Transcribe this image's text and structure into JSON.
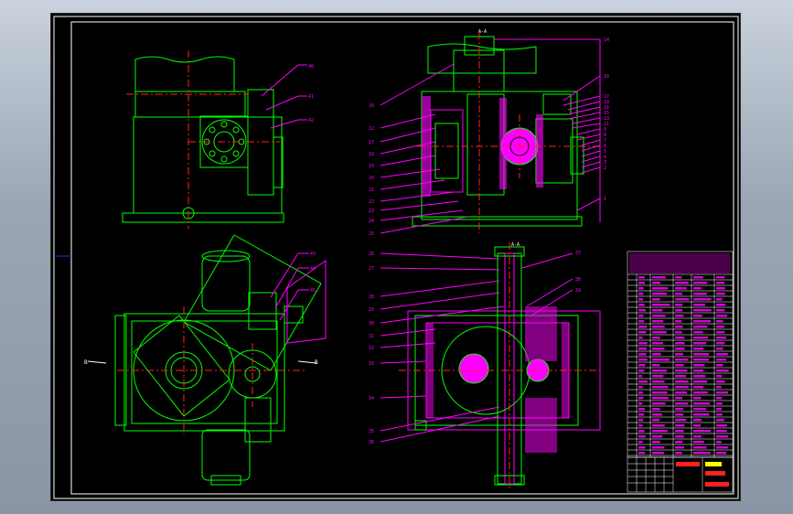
{
  "colors": {
    "background": "#000000",
    "frame": "#2b2bd6",
    "outline": "#00ff00",
    "leaders": "#ff00ff",
    "centerlines": "#ff2020",
    "section_fill": "#ff00ff",
    "table_lines": "#ffffff",
    "accent_yellow": "#ffff00"
  },
  "section_labels": {
    "top": "A-A",
    "bottom": "A-A"
  },
  "side_markers": {
    "left": "B",
    "right": "B"
  },
  "balloons_left_top": [
    "40",
    "41",
    "42"
  ],
  "balloons_left_bottom": [
    "43",
    "44",
    "45"
  ],
  "balloons_top_section_left": [
    "16",
    "12",
    "17",
    "18",
    "19",
    "20",
    "21",
    "22",
    "23",
    "24",
    "25"
  ],
  "balloons_top_section_right": [
    "14",
    "10",
    "17",
    "18",
    "16",
    "15",
    "13",
    "11",
    "9",
    "8",
    "7",
    "6",
    "5",
    "4",
    "3",
    "2",
    "1"
  ],
  "balloons_bottom_section_left": [
    "26",
    "27",
    "28",
    "29",
    "30",
    "31",
    "32",
    "33",
    "34",
    "35",
    "36"
  ],
  "balloons_bottom_section_right": [
    "37",
    "38",
    "39"
  ],
  "icons": {
    "circle_marks": "bolt-circle-icon",
    "center_cross": "center-cross-icon"
  }
}
